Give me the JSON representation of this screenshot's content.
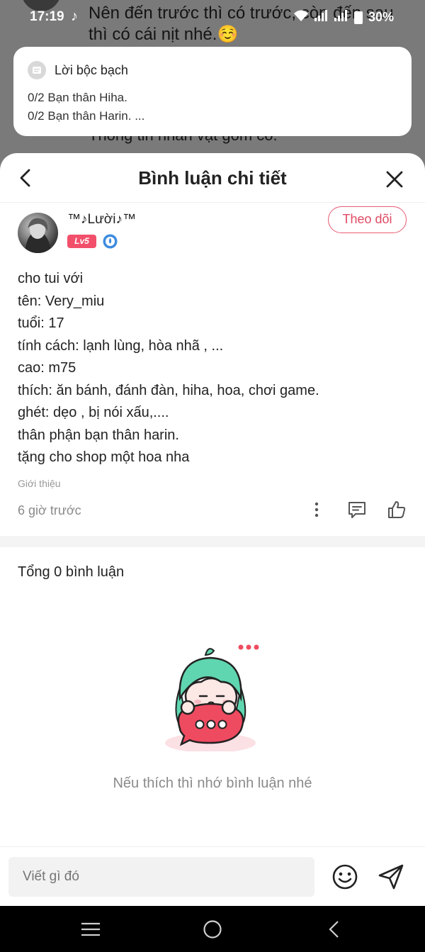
{
  "status_bar": {
    "time": "17:19",
    "battery": "30%"
  },
  "background": {
    "post_text": "Nên đến trước thì có trước, còn đến sau thì có cái nịt nhé.☺️",
    "post_text_below": "Thông tin nhân vật gồm có:"
  },
  "notification": {
    "title": "Lời bộc bạch",
    "lines": [
      "0/2 Bạn thân Hiha.",
      "0/2 Bạn thân Harin. ..."
    ]
  },
  "sheet": {
    "title": "Bình luận chi tiết"
  },
  "author": {
    "name": "™♪Lười♪™",
    "level": "Lv5",
    "follow_label": "Theo dõi"
  },
  "comment": {
    "lines": [
      "cho tui với",
      "tên: Very_miu",
      "tuổi: 17",
      "tính cách: lạnh lùng, hòa nhã , ...",
      "cao: m75",
      "thích: ăn bánh, đánh đàn, hiha, hoa, chơi game.",
      "ghét: dẹo , bị nói xấu,....",
      "thân phận bạn thân harin.",
      "tặng cho shop một hoa nha"
    ],
    "tag": "Giới thiệu",
    "time": "6 giờ trước"
  },
  "comments_section": {
    "total": "Tổng 0 bình luận",
    "empty_text": "Nếu thích thì nhớ bình luận nhé"
  },
  "input": {
    "placeholder": "Viết gì đó"
  },
  "colors": {
    "accent": "#e04a64",
    "badge": "#f24f6b",
    "mascot_hair": "#5fd6b0",
    "bubble": "#ef4b60"
  }
}
